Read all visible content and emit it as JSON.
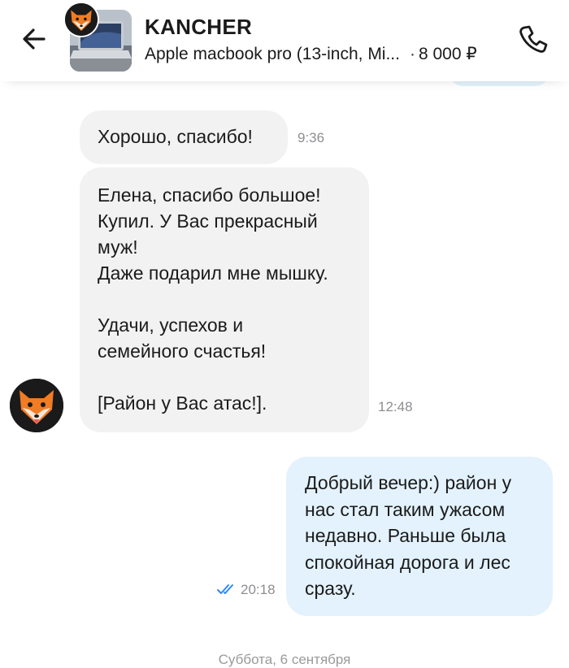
{
  "header": {
    "seller_name": "KANCHER",
    "listing_title": "Apple macbook pro (13-inch, Mi...",
    "price": "8 000 ₽",
    "price_separator": "·"
  },
  "messages": [
    {
      "direction": "incoming",
      "text": "Хорошо, спасибо!",
      "time": "9:36"
    },
    {
      "direction": "incoming",
      "text": "Елена, спасибо большое!\nКупил. У Вас прекрасный\nмуж!\nДаже подарил мне мышку.\n\nУдачи, успехов и\nсемейного счастья!\n\n[Район у Вас атас!].",
      "time": "12:48"
    },
    {
      "direction": "outgoing",
      "text": "Добрый вечер:) район у\nнас стал таким ужасом\nнедавно. Раньше была\nспокойная дорога и лес\nсразу.",
      "time": "20:18",
      "status": "read"
    }
  ],
  "date_separator": "Суббота, 6 сентября",
  "icons": {
    "back": "arrow-left-icon",
    "call": "phone-icon",
    "read_status": "double-check-icon",
    "avatar": "fox-avatar"
  },
  "colors": {
    "incoming_bubble": "#f2f2f2",
    "outgoing_bubble": "#e3f2fd",
    "read_check": "#2f8af5",
    "time_text": "#8e8e93"
  }
}
